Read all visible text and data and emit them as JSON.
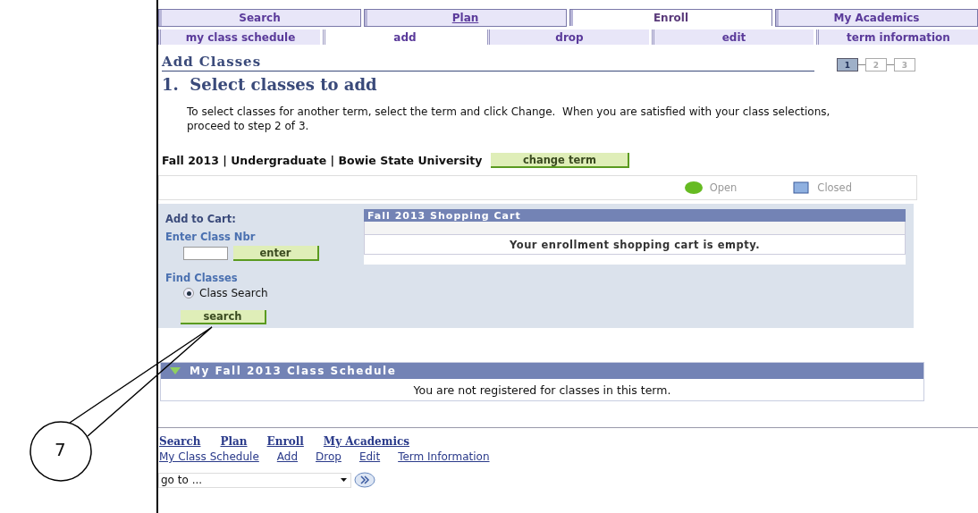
{
  "tabs": [
    {
      "label": "Search",
      "selected": false,
      "underlined": false
    },
    {
      "label": "Plan",
      "selected": false,
      "underlined": true
    },
    {
      "label": "Enroll",
      "selected": true,
      "underlined": false
    },
    {
      "label": "My Academics",
      "selected": false,
      "underlined": false
    }
  ],
  "subtabs": [
    {
      "label": "my class schedule",
      "selected": false
    },
    {
      "label": "add",
      "selected": true
    },
    {
      "label": "drop",
      "selected": false
    },
    {
      "label": "edit",
      "selected": false
    },
    {
      "label": "term information",
      "selected": false
    }
  ],
  "page_title": "Add Classes",
  "steps": [
    {
      "label": "1",
      "selected": true
    },
    {
      "label": "2",
      "selected": false
    },
    {
      "label": "3",
      "selected": false
    }
  ],
  "heading": "1.  Select classes to add",
  "instructions": "To select classes for another term, select the term and click Change.  When you are satisfied with your class selections, proceed to step 2 of 3.",
  "term": "Fall 2013 | Undergraduate | Bowie State University",
  "change_term_button": "change term",
  "legend": [
    {
      "kind": "circle",
      "label": "Open",
      "color": "#66bb22"
    },
    {
      "kind": "square",
      "label": "Closed",
      "color": "#8fb0e0"
    }
  ],
  "add_to_cart": {
    "title": "Add to Cart:",
    "class_nbr_label": "Enter Class Nbr",
    "enter_button": "enter",
    "find_label": "Find Classes",
    "options": [
      {
        "label": "Class Search",
        "selected": true
      }
    ],
    "search_button": "search"
  },
  "cart": {
    "title": "Fall 2013 Shopping Cart",
    "message": "Your enrollment shopping cart is empty."
  },
  "schedule": {
    "title": "My Fall 2013 Class Schedule",
    "expanded": true,
    "message": "You are not registered for classes in this term."
  },
  "footer_links": [
    "Search",
    "Plan",
    "Enroll",
    "My Academics"
  ],
  "footer_sublinks": [
    "My Class Schedule",
    "Add",
    "Drop",
    "Edit",
    "Term Information"
  ],
  "goto": {
    "value": "go to ..."
  },
  "callout": {
    "label": "7"
  }
}
